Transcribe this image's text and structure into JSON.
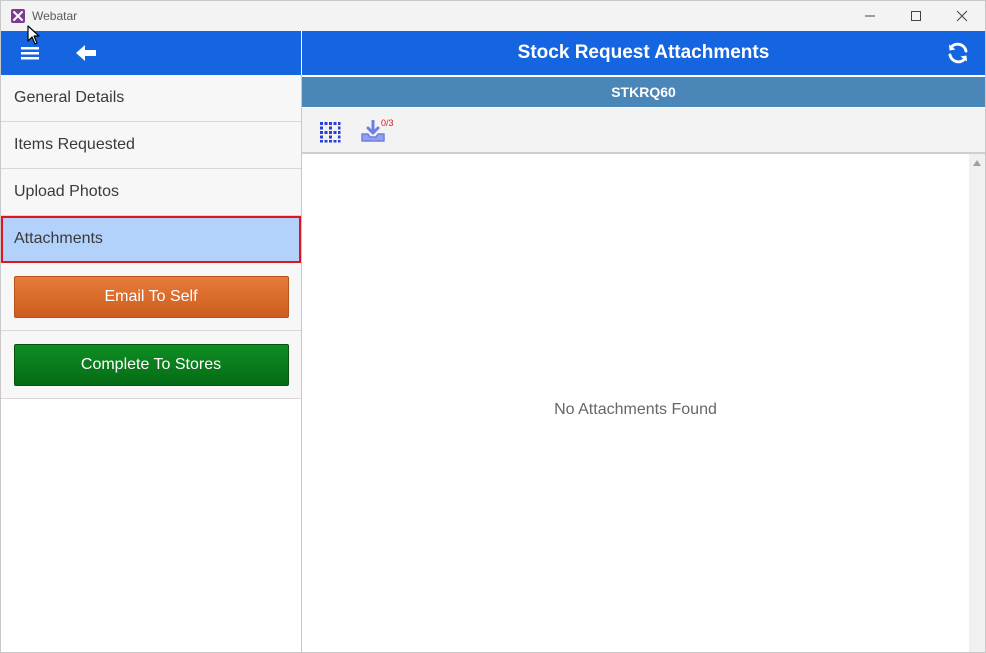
{
  "window": {
    "title": "Webatar",
    "controls": [
      "minimize-icon",
      "maximize-icon",
      "close-icon"
    ]
  },
  "sidebar": {
    "items": [
      {
        "label": "General Details",
        "active": false
      },
      {
        "label": "Items Requested",
        "active": false
      },
      {
        "label": "Upload Photos",
        "active": false
      },
      {
        "label": "Attachments",
        "active": true
      }
    ],
    "email_button": "Email To Self",
    "complete_button": "Complete To Stores"
  },
  "header": {
    "title": "Stock Request Attachments",
    "subtitle": "STKRQ60"
  },
  "toolbar": {
    "download_badge": "0/3"
  },
  "content": {
    "empty_message": "No Attachments Found"
  },
  "colors": {
    "header_blue": "#1565e0",
    "subheader_blue": "#4b86b8",
    "active_item": "#b3d2fb",
    "active_outline": "#e0141e",
    "email_button": "#d96a2b",
    "complete_button": "#097c1c"
  }
}
